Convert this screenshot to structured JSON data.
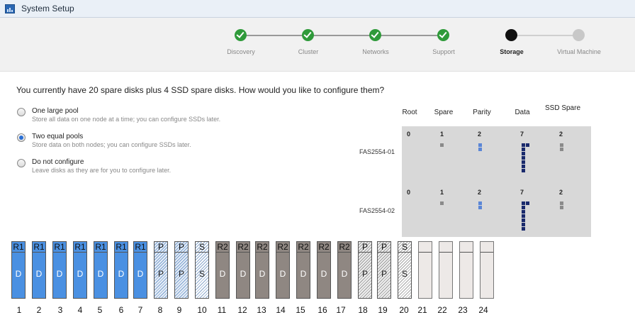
{
  "window": {
    "title": "System Setup",
    "icon": "app-window-icon"
  },
  "wizard": {
    "steps": [
      {
        "label": "Discovery",
        "status": "done"
      },
      {
        "label": "Cluster",
        "status": "done"
      },
      {
        "label": "Networks",
        "status": "done"
      },
      {
        "label": "Support",
        "status": "done"
      },
      {
        "label": "Storage",
        "status": "current"
      },
      {
        "label": "Virtual Machine",
        "status": "future"
      }
    ],
    "colors": {
      "done": "#2f9a3a",
      "current": "#111111",
      "future": "#c8c8c8"
    }
  },
  "question": "You currently have 20 spare disks plus 4 SSD spare disks. How would you like to configure them?",
  "options": [
    {
      "label": "One large pool",
      "description": "Store all data on one node at a time; you can configure SSDs later.",
      "selected": false
    },
    {
      "label": "Two equal pools",
      "description": "Store data on both nodes; you can configure SSDs later.",
      "selected": true
    },
    {
      "label": "Do not configure",
      "description": "Leave disks as they are for you to configure later.",
      "selected": false
    }
  ],
  "summary": {
    "columns": [
      "Root",
      "Spare",
      "Parity",
      "Data",
      "SSD Spare"
    ],
    "nodes": [
      {
        "name": "FAS2554-01",
        "counts": [
          "0",
          "1",
          "2",
          "7",
          "2"
        ]
      },
      {
        "name": "FAS2554-02",
        "counts": [
          "0",
          "1",
          "2",
          "7",
          "2"
        ]
      }
    ]
  },
  "disks": [
    {
      "number": "1",
      "top": "R1",
      "middle": "D",
      "style": "r1"
    },
    {
      "number": "2",
      "top": "R1",
      "middle": "D",
      "style": "r1"
    },
    {
      "number": "3",
      "top": "R1",
      "middle": "D",
      "style": "r1"
    },
    {
      "number": "4",
      "top": "R1",
      "middle": "D",
      "style": "r1"
    },
    {
      "number": "5",
      "top": "R1",
      "middle": "D",
      "style": "r1"
    },
    {
      "number": "6",
      "top": "R1",
      "middle": "D",
      "style": "r1"
    },
    {
      "number": "7",
      "top": "R1",
      "middle": "D",
      "style": "r1"
    },
    {
      "number": "8",
      "top": "P",
      "middle": "P",
      "style": "pb"
    },
    {
      "number": "9",
      "top": "P",
      "middle": "P",
      "style": "pb"
    },
    {
      "number": "10",
      "top": "S",
      "middle": "S",
      "style": "sb"
    },
    {
      "number": "11",
      "top": "R2",
      "middle": "D",
      "style": "r2"
    },
    {
      "number": "12",
      "top": "R2",
      "middle": "D",
      "style": "r2"
    },
    {
      "number": "13",
      "top": "R2",
      "middle": "D",
      "style": "r2"
    },
    {
      "number": "14",
      "top": "R2",
      "middle": "D",
      "style": "r2"
    },
    {
      "number": "15",
      "top": "R2",
      "middle": "D",
      "style": "r2"
    },
    {
      "number": "16",
      "top": "R2",
      "middle": "D",
      "style": "r2"
    },
    {
      "number": "17",
      "top": "R2",
      "middle": "D",
      "style": "r2"
    },
    {
      "number": "18",
      "top": "P",
      "middle": "P",
      "style": "pg"
    },
    {
      "number": "19",
      "top": "P",
      "middle": "P",
      "style": "pg"
    },
    {
      "number": "20",
      "top": "S",
      "middle": "S",
      "style": "sg"
    },
    {
      "number": "21",
      "top": "",
      "middle": "",
      "style": "empty"
    },
    {
      "number": "22",
      "top": "",
      "middle": "",
      "style": "empty"
    },
    {
      "number": "23",
      "top": "",
      "middle": "",
      "style": "empty"
    },
    {
      "number": "24",
      "top": "",
      "middle": "",
      "style": "empty"
    }
  ],
  "colors": {
    "pool1": "#4a90e2",
    "pool2": "#8f8782",
    "parity_square": "#5b86d6",
    "data_square": "#1a2a6c",
    "spare_square": "#8a8a8a"
  }
}
